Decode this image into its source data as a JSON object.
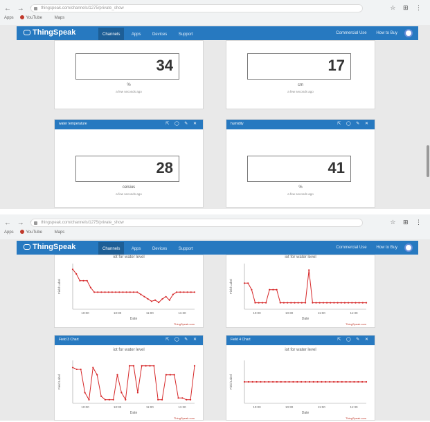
{
  "screens": [
    {
      "browser": {
        "url": "thingspeak.com/channels/1275/private_show",
        "bookmarks": [
          "Apps",
          "YouTube",
          "Maps"
        ]
      },
      "nav": {
        "brand": "ThingSpeak",
        "items": [
          "Channels",
          "Apps",
          "Devices",
          "Support"
        ],
        "right": [
          "Commercial Use",
          "How to Buy"
        ]
      },
      "widgets": {
        "top_left": {
          "value": "34",
          "unit": "%",
          "ago": "a few seconds ago"
        },
        "top_right": {
          "value": "17",
          "unit": "cm",
          "ago": "a few seconds ago"
        },
        "bottom_left": {
          "title": "water temperature",
          "value": "28",
          "unit": "celsius",
          "ago": "a few seconds ago"
        },
        "bottom_right": {
          "title": "humidity",
          "value": "41",
          "unit": "%",
          "ago": "a few seconds ago"
        }
      }
    },
    {
      "browser": {
        "url": "thingspeak.com/channels/1275/private_show",
        "bookmarks": [
          "Apps",
          "YouTube",
          "Maps"
        ]
      },
      "nav": {
        "brand": "ThingSpeak",
        "items": [
          "Channels",
          "Apps",
          "Devices",
          "Support"
        ],
        "right": [
          "Commercial Use",
          "How to Buy"
        ]
      },
      "charts": {
        "top_left": {
          "title": "iot for water level",
          "xlabel": "Date",
          "credit": "ThingSpeak.com"
        },
        "top_right": {
          "title": "iot for water level",
          "xlabel": "Date",
          "credit": "ThingSpeak.com"
        },
        "bottom_left": {
          "panel_title": "Field 3 Chart",
          "title": "iot for water level",
          "xlabel": "Date",
          "credit": "ThingSpeak.com"
        },
        "bottom_right": {
          "panel_title": "Field 4 Chart",
          "title": "iot for water level",
          "xlabel": "Date",
          "credit": "ThingSpeak.com"
        }
      }
    }
  ],
  "chart_data": [
    {
      "type": "line",
      "title": "iot for water level",
      "xlabel": "Date",
      "ylabel": "Field Label",
      "values": [
        5,
        4.6,
        4,
        4,
        4,
        3.4,
        3,
        3,
        3,
        3,
        3,
        3,
        3,
        3,
        3,
        3,
        3,
        3,
        3,
        2.8,
        2.6,
        2.4,
        2.2,
        2.3,
        2.1,
        2.4,
        2.6,
        2.3,
        2.8,
        3,
        3,
        3,
        3,
        3,
        3
      ],
      "xticks": [
        "10:00",
        "10:30",
        "11:00",
        "11:30"
      ],
      "ylim": [
        1.5,
        5.5
      ],
      "color": "#d62728"
    },
    {
      "type": "line",
      "title": "iot for water level",
      "xlabel": "Date",
      "ylabel": "Field Label",
      "values": [
        4,
        4,
        3,
        1,
        1,
        1,
        1,
        3,
        3,
        3,
        1,
        1,
        1,
        1,
        1,
        1,
        1,
        1,
        6,
        1,
        1,
        1,
        1,
        1,
        1,
        1,
        1,
        1,
        1,
        1,
        1,
        1,
        1,
        1,
        1
      ],
      "xticks": [
        "10:00",
        "10:30",
        "11:00",
        "11:30"
      ],
      "ylim": [
        0,
        7
      ],
      "color": "#d62728"
    },
    {
      "type": "line",
      "title": "iot for water level",
      "xlabel": "Date",
      "ylabel": "Field Label",
      "values": [
        34,
        33,
        33,
        20,
        16,
        34,
        30,
        18,
        16,
        16,
        16,
        30,
        20,
        16,
        35,
        35,
        20,
        35,
        35,
        35,
        35,
        16,
        16,
        30,
        30,
        30,
        17,
        17,
        16,
        16,
        35
      ],
      "xticks": [
        "10:00",
        "10:30",
        "11:00",
        "11:30"
      ],
      "ylim": [
        14,
        38
      ],
      "color": "#d62728"
    },
    {
      "type": "line",
      "title": "iot for water level",
      "xlabel": "Date",
      "ylabel": "Field Label",
      "values": [
        25,
        25,
        25,
        25,
        25,
        25,
        25,
        25,
        25,
        25,
        25,
        25,
        25,
        25,
        25,
        25,
        25,
        25,
        25,
        25,
        25,
        25,
        25,
        25,
        25,
        25,
        25,
        25,
        25,
        25,
        25
      ],
      "xticks": [
        "10:00",
        "10:30",
        "11:00",
        "11:30"
      ],
      "ylim": [
        0,
        50
      ],
      "color": "#d62728"
    }
  ]
}
